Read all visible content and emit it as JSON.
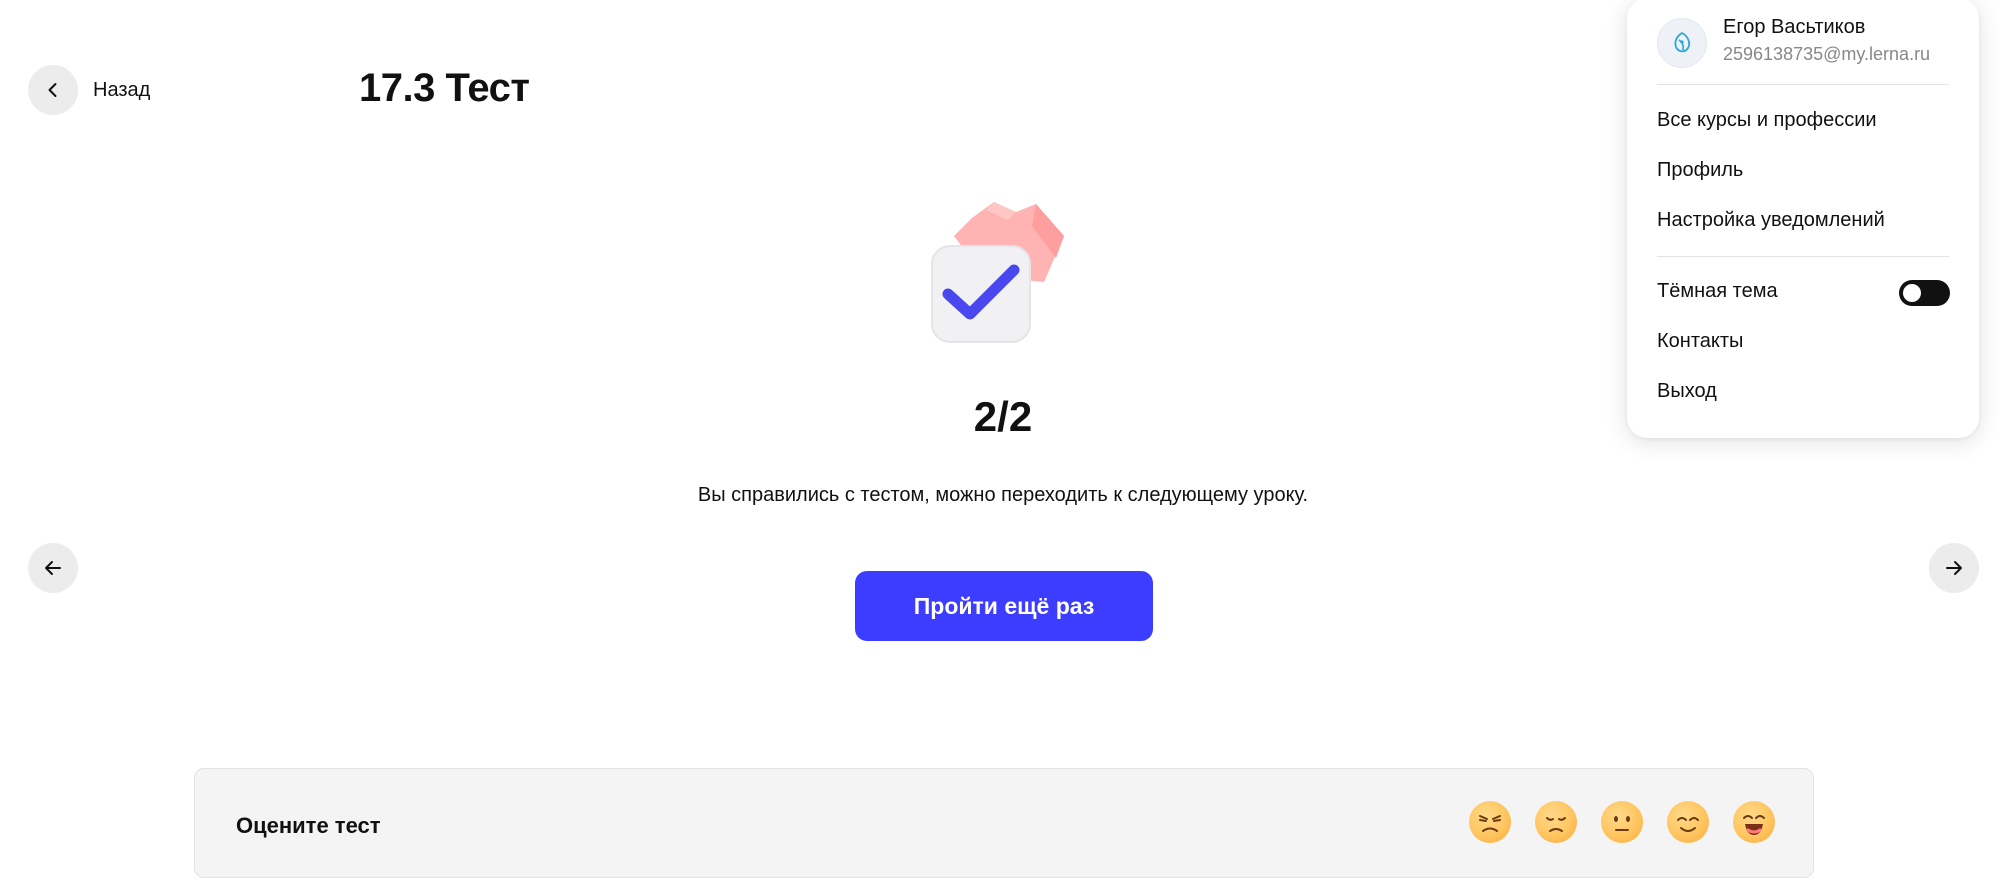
{
  "header": {
    "back_label": "Назад",
    "lesson_title": "17.3 Тест"
  },
  "result": {
    "score": "2/2",
    "message": "Вы справились с тестом, можно переходить к следующему уроку.",
    "retry_label": "Пройти ещё раз"
  },
  "rating": {
    "label": "Оцените тест",
    "emojis": [
      "angry-face",
      "sad-face",
      "neutral-face",
      "smiling-face",
      "grinning-face"
    ]
  },
  "profile_menu": {
    "user_name": "Егор Васьтиков",
    "user_email": "2596138735@my.lerna.ru",
    "items": [
      {
        "label": "Все курсы и профессии"
      },
      {
        "label": "Профиль"
      },
      {
        "label": "Настройка уведомлений"
      }
    ],
    "dark_theme_label": "Тёмная тема",
    "dark_theme_enabled": false,
    "contacts_label": "Контакты",
    "logout_label": "Выход"
  },
  "colors": {
    "accent": "#3d3dff",
    "check": "#4a47ee",
    "emoji": "#ffc560"
  }
}
